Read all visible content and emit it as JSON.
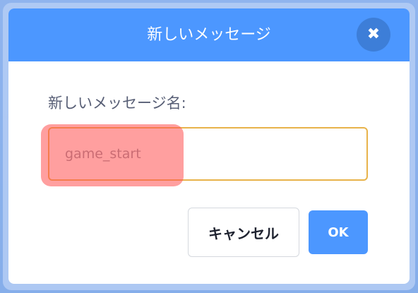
{
  "dialog": {
    "title": "新しいメッセージ",
    "close_icon": "close-icon",
    "field_label": "新しいメッセージ名:",
    "input_value": "game_start",
    "cancel_label": "キャンセル",
    "ok_label": "OK"
  },
  "colors": {
    "header": "#4c97ff",
    "close_button": "#3d7ed8",
    "input_border": "#e8b34a",
    "ok_button": "#4c97ff",
    "highlight": "#ff5050"
  }
}
